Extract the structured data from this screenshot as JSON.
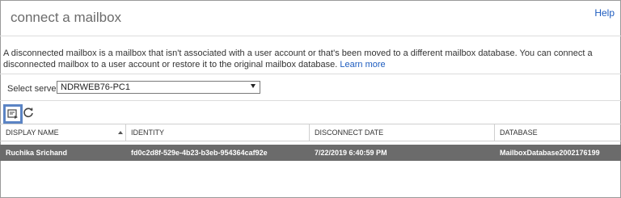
{
  "header": {
    "title": "connect a mailbox",
    "help_label": "Help"
  },
  "description": {
    "text": "A disconnected mailbox is a mailbox that isn't associated with a user account or that's been moved to a different mailbox database. You can connect a disconnected mailbox to a user account or restore it to the original mailbox database. ",
    "learn_more": "Learn more"
  },
  "server": {
    "label": "Select server:",
    "selected": "NDRWEB76-PC1"
  },
  "toolbar": {
    "icons": [
      "connect-icon",
      "refresh-icon"
    ],
    "accent": "#5b84c4"
  },
  "table": {
    "columns": [
      "DISPLAY NAME",
      "IDENTITY",
      "DISCONNECT DATE",
      "DATABASE"
    ],
    "sort_column": "DISPLAY NAME",
    "rows": [
      {
        "display_name": "Ruchika Srichand",
        "identity": "fd0c2d8f-529e-4b23-b3eb-954364caf92e",
        "disconnect_date": "7/22/2019 6:40:59 PM",
        "database": "MailboxDatabase2002176199"
      }
    ],
    "selected_row_color": "#6b6b6b"
  }
}
